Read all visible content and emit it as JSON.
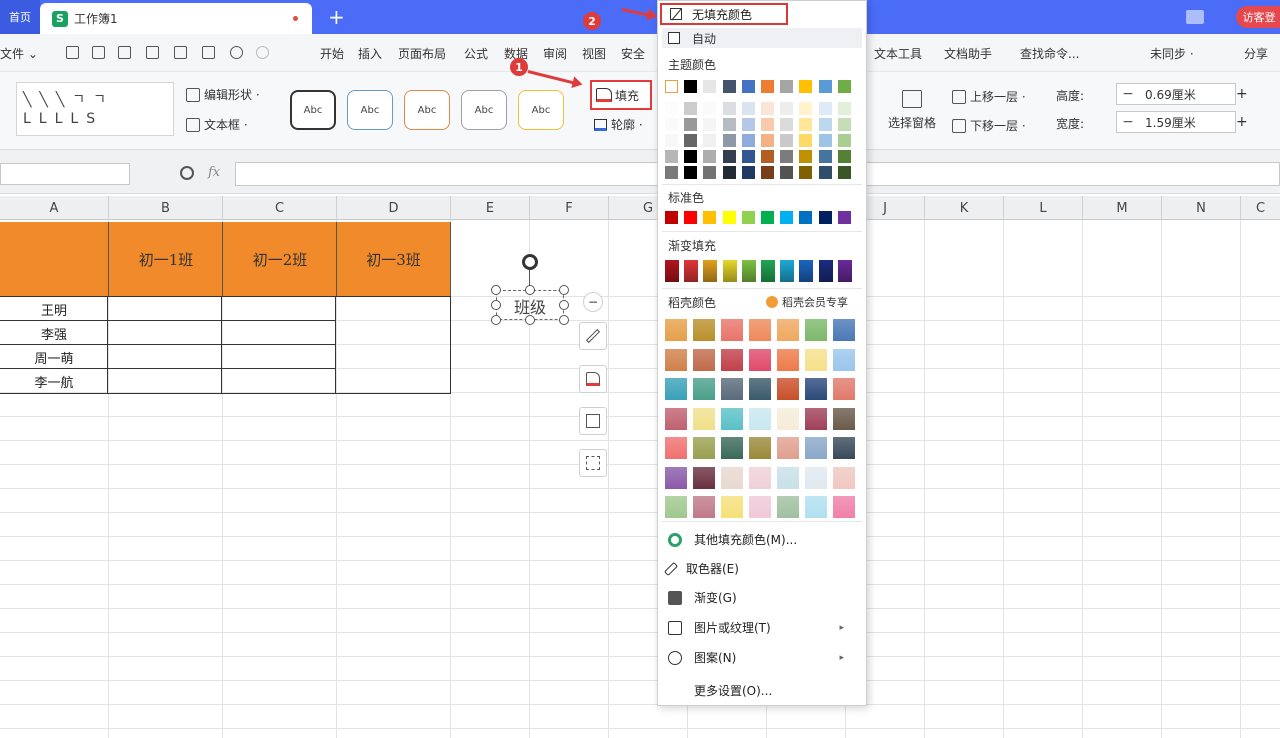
{
  "titlebar": {
    "home_tab": "首页",
    "doc_tab": "工作簿1",
    "sheet_icon": "S",
    "new_tab": "+",
    "visitor": "访客登"
  },
  "menu": {
    "file": "文件 ⌄",
    "items": [
      "开始",
      "插入",
      "页面布局",
      "公式",
      "数据",
      "审阅",
      "视图",
      "安全"
    ],
    "right_items": [
      "文本工具",
      "文档助手",
      "查找命令...",
      "未同步 ·",
      "分享"
    ]
  },
  "ribbon": {
    "edit_shape": "编辑形状 ·",
    "text_box": "文本框 ·",
    "style_label": "Abc",
    "fill": "填充",
    "outline": "轮廓 ·",
    "select_pane": "选择窗格",
    "bring_forward": "上移一层 ·",
    "send_backward": "下移一层 ·",
    "height_label": "高度:",
    "height_value": "0.69厘米",
    "width_label": "宽度:",
    "width_value": "1.59厘米",
    "minus": "−",
    "plus": "+"
  },
  "formula": {
    "fx": "fx"
  },
  "sheet": {
    "columns": [
      "A",
      "B",
      "C",
      "D",
      "E",
      "F",
      "G",
      "H",
      "I",
      "J",
      "K",
      "L",
      "M",
      "N",
      "C"
    ],
    "class_headers": [
      "初一1班",
      "初一2班",
      "初一3班"
    ],
    "names": [
      "王明",
      "李强",
      "周一萌",
      "李一航"
    ],
    "shape_text": "班级",
    "collapse": "−"
  },
  "dropdown": {
    "no_fill": "无填充颜色",
    "auto": "自动",
    "theme_colors": "主题颜色",
    "standard_colors": "标准色",
    "gradient_fill": "渐变填充",
    "texture_colors": "稻壳颜色",
    "member_only": "稻壳会员专享",
    "more_fill_colors": "其他填充颜色(M)...",
    "eyedropper": "取色器(E)",
    "gradient": "渐变(G)",
    "picture_texture": "图片或纹理(T)",
    "pattern": "图案(N)",
    "more_settings": "更多设置(O)...",
    "theme_row": [
      "#ffffff",
      "#000000",
      "#e7e6e6",
      "#44546a",
      "#4472c4",
      "#ed7d31",
      "#a5a5a5",
      "#ffc000",
      "#5b9bd5",
      "#70ad47"
    ],
    "standard_row": [
      "#c00000",
      "#ff0000",
      "#ffc000",
      "#ffff00",
      "#92d050",
      "#00b050",
      "#00b0f0",
      "#0070c0",
      "#002060",
      "#7030a0"
    ],
    "gradient_row": [
      "#b2141d",
      "#e0363a",
      "#e0a020",
      "#e6d82a",
      "#7cc242",
      "#22a655",
      "#1fa9d6",
      "#1c64c0",
      "#1c2c80",
      "#6a2a9a"
    ]
  },
  "annotations": {
    "step1": "1",
    "step2": "2"
  },
  "colors": {
    "header_blue": "#4a6cf7",
    "orange": "#f08a2a",
    "highlight_red": "#e03b3b"
  }
}
